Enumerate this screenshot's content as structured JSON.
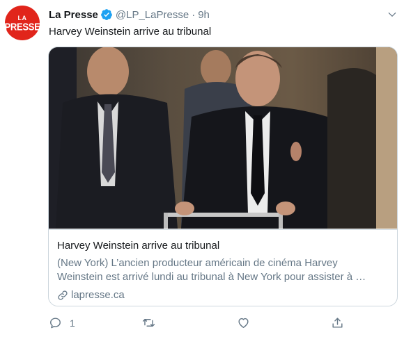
{
  "author": {
    "avatar_text_line1": "LA",
    "avatar_text_line2": "PRESSE",
    "name": "La Presse",
    "handle": "@LP_LaPresse",
    "separator": "·",
    "time": "9h"
  },
  "tweet": {
    "text": "Harvey Weinstein arrive au tribunal"
  },
  "card": {
    "title": "Harvey Weinstein arrive au tribunal",
    "description_line1": "(New York) L’ancien producteur américain de cinéma Harvey",
    "description_line2": "Weinstein est arrivé lundi au tribunal à New York pour assister à …",
    "domain": "lapresse.ca"
  },
  "actions": {
    "reply_count": "1"
  },
  "colors": {
    "brand": "#e1251b",
    "verified": "#1da1f2",
    "muted": "#657786",
    "border": "#ccd6dd"
  },
  "icons": {
    "verified": "verified-badge-icon",
    "caret": "chevron-down-icon",
    "link": "link-icon",
    "reply": "reply-icon",
    "retweet": "retweet-icon",
    "like": "heart-icon",
    "share": "share-icon"
  }
}
